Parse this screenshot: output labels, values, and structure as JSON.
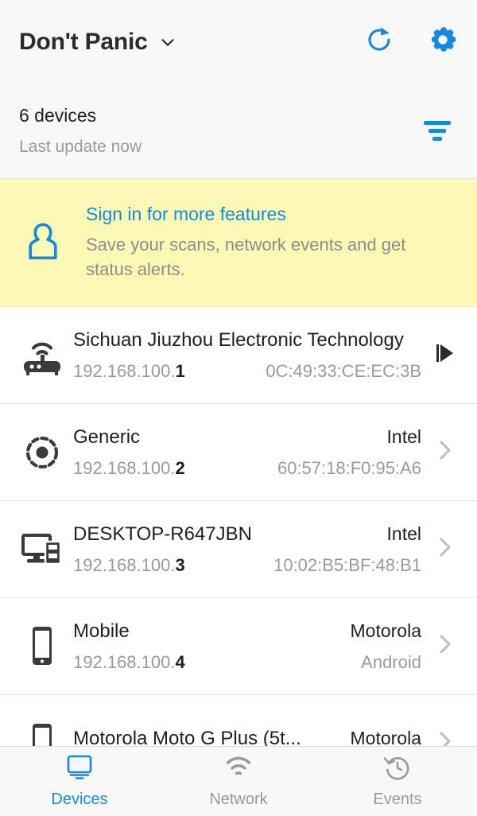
{
  "appbar": {
    "title": "Don't Panic",
    "dropdown_icon": "chevron-down-icon",
    "refresh_icon": "refresh-icon",
    "settings_icon": "gear-icon",
    "accent_color": "#1289e6"
  },
  "summary": {
    "device_count": "6 devices",
    "last_update": "Last update now",
    "filter_icon": "filter-icon"
  },
  "banner": {
    "icon": "person-icon",
    "title": "Sign in for more features",
    "subtitle": "Save your scans, network events and get status alerts.",
    "background_color": "#fbf9b4",
    "link_color": "#1289e6"
  },
  "devices": [
    {
      "icon": "router-icon",
      "name": "Sichuan Jiuzhou Electronic Technology",
      "vendor": "",
      "ip_prefix": "192.168.100.",
      "ip_last": "1",
      "meta": "0C:49:33:CE:EC:3B",
      "trailing_icon": "play-marker-icon"
    },
    {
      "icon": "generic-device-icon",
      "name": "Generic",
      "vendor": "Intel",
      "ip_prefix": "192.168.100.",
      "ip_last": "2",
      "meta": "60:57:18:F0:95:A6",
      "trailing_icon": "chevron-right-icon"
    },
    {
      "icon": "desktop-icon",
      "name": "DESKTOP-R647JBN",
      "vendor": "Intel",
      "ip_prefix": "192.168.100.",
      "ip_last": "3",
      "meta": "10:02:B5:BF:48:B1",
      "trailing_icon": "chevron-right-icon"
    },
    {
      "icon": "mobile-icon",
      "name": "Mobile",
      "vendor": "Motorola",
      "ip_prefix": "192.168.100.",
      "ip_last": "4",
      "meta": "Android",
      "trailing_icon": "chevron-right-icon"
    },
    {
      "icon": "mobile-icon",
      "name": "Motorola Moto G Plus (5t...",
      "vendor": "Motorola",
      "ip_prefix": "",
      "ip_last": "",
      "meta": "",
      "trailing_icon": "chevron-right-icon"
    }
  ],
  "bottom_nav": [
    {
      "icon": "monitor-icon",
      "label": "Devices",
      "active": true
    },
    {
      "icon": "wifi-icon",
      "label": "Network",
      "active": false
    },
    {
      "icon": "history-clock-icon",
      "label": "Events",
      "active": false
    }
  ]
}
